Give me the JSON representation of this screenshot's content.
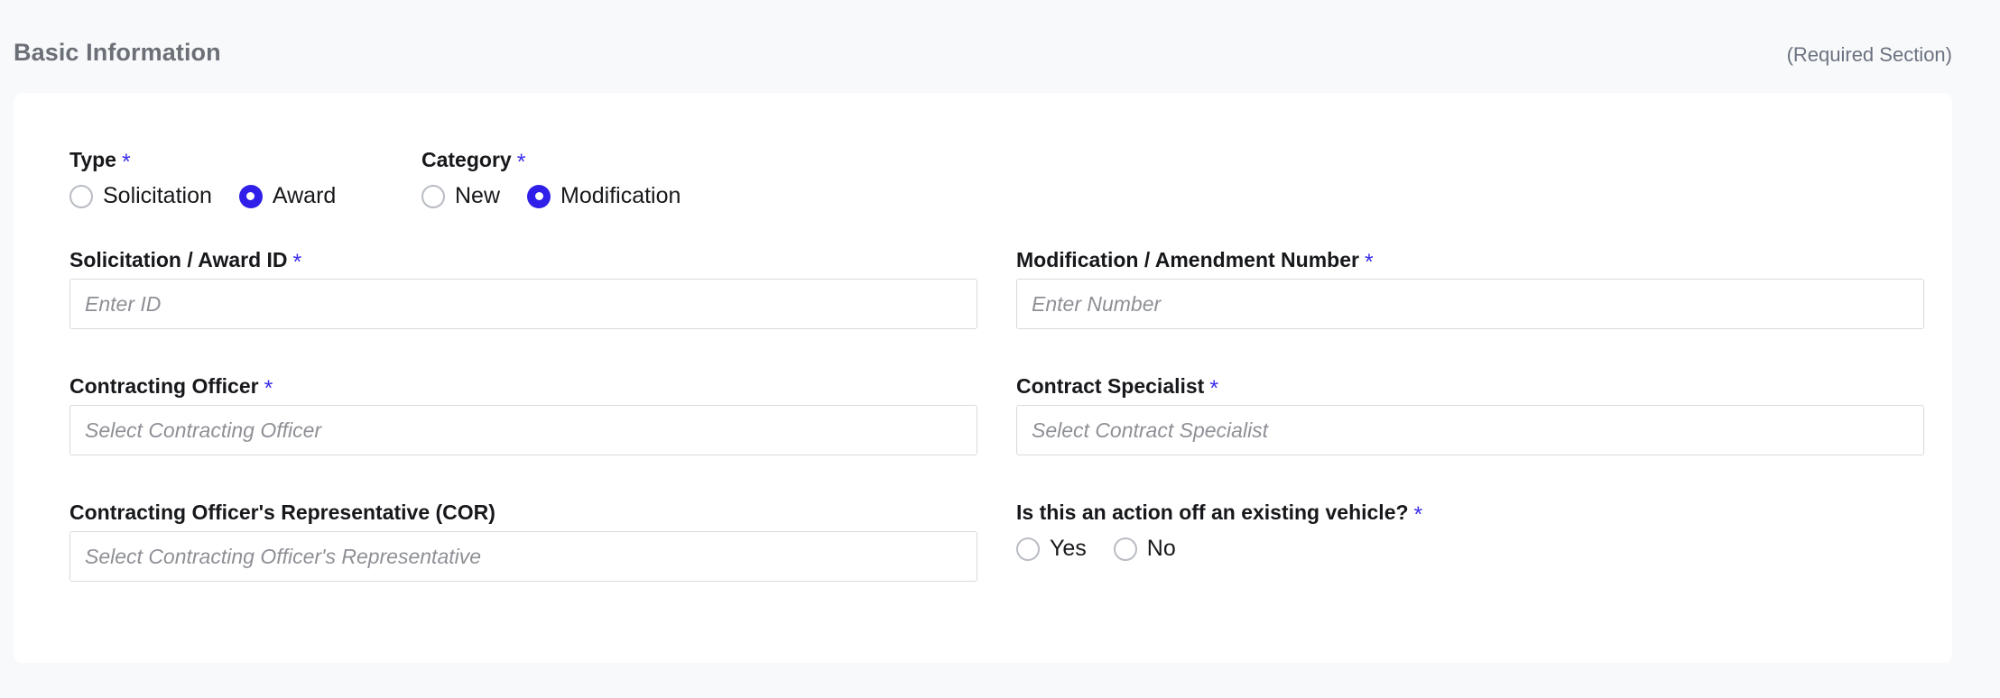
{
  "section": {
    "title": "Basic Information",
    "required_note": "(Required Section)"
  },
  "colors": {
    "page_background": "#f8f9fb",
    "card_background": "#ffffff",
    "accent": "#2f1fe8",
    "required_star": "#3b2fe8",
    "label_text": "#17181b",
    "title_text": "#6b6f76",
    "placeholder_text": "#8e9096",
    "input_border": "#d9dade",
    "radio_border": "#b9bcc3"
  },
  "fields": {
    "type": {
      "label": "Type",
      "required_marker": "*",
      "options": [
        {
          "label": "Solicitation",
          "selected": false
        },
        {
          "label": "Award",
          "selected": true
        }
      ]
    },
    "category": {
      "label": "Category",
      "required_marker": "*",
      "options": [
        {
          "label": "New",
          "selected": false
        },
        {
          "label": "Modification",
          "selected": true
        }
      ]
    },
    "solicitation_award_id": {
      "label": "Solicitation / Award ID",
      "required_marker": "*",
      "placeholder": "Enter ID",
      "value": ""
    },
    "modification_amendment_number": {
      "label": "Modification / Amendment Number",
      "required_marker": "*",
      "placeholder": "Enter Number",
      "value": ""
    },
    "contracting_officer": {
      "label": "Contracting Officer",
      "required_marker": "*",
      "placeholder": "Select Contracting Officer",
      "value": ""
    },
    "contract_specialist": {
      "label": "Contract Specialist",
      "required_marker": "*",
      "placeholder": "Select Contract Specialist",
      "value": ""
    },
    "contracting_officers_representative": {
      "label": "Contracting Officer's Representative (COR)",
      "required_marker": "",
      "placeholder": "Select Contracting Officer's Representative",
      "value": ""
    },
    "existing_vehicle": {
      "label": "Is this an action off an existing vehicle?",
      "required_marker": "*",
      "options": [
        {
          "label": "Yes",
          "selected": false
        },
        {
          "label": "No",
          "selected": false
        }
      ]
    }
  }
}
